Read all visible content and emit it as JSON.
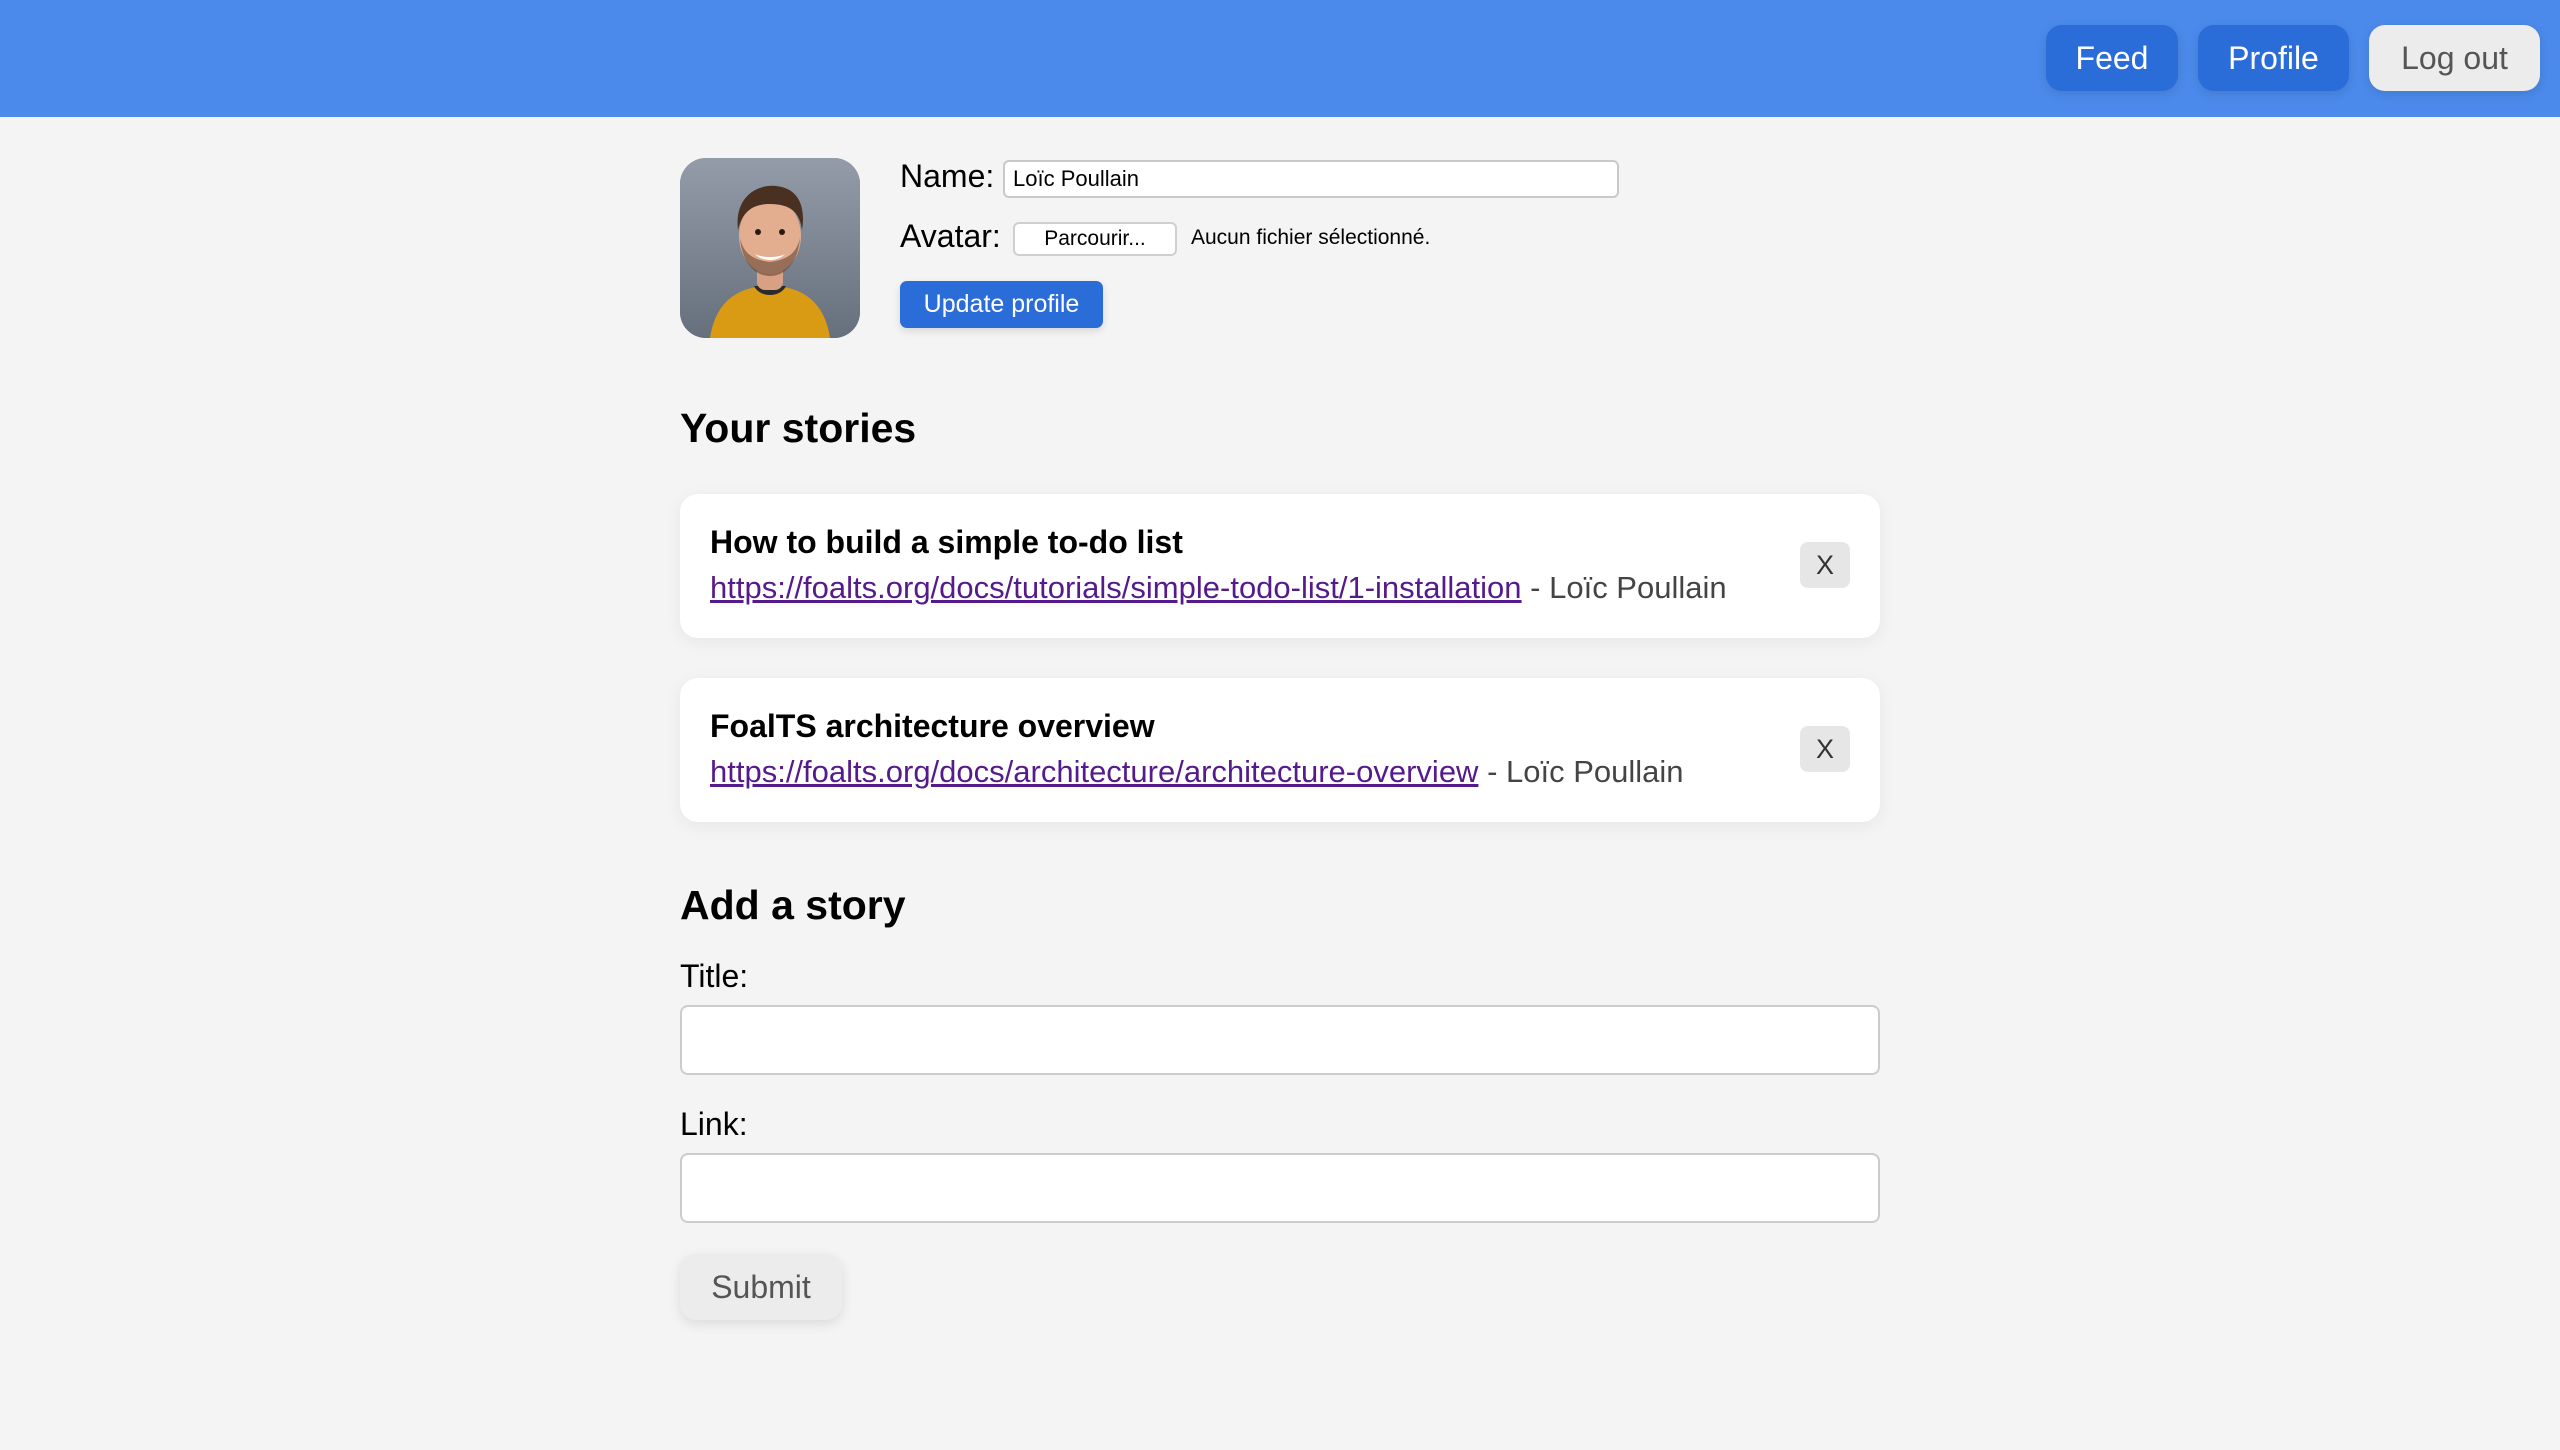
{
  "nav": {
    "feed_label": "Feed",
    "profile_label": "Profile",
    "logout_label": "Log out"
  },
  "profile": {
    "name_label": "Name:",
    "name_value": "Loïc Poullain",
    "avatar_label": "Avatar:",
    "file_button_label": "Parcourir...",
    "file_status": "Aucun fichier sélectionné.",
    "update_label": "Update profile"
  },
  "stories": {
    "heading": "Your stories",
    "items": [
      {
        "title": "How to build a simple to-do list",
        "link": "https://foalts.org/docs/tutorials/simple-todo-list/1-installation",
        "author": "Loïc Poullain",
        "separator": " - ",
        "delete_label": "X"
      },
      {
        "title": "FoalTS architecture overview",
        "link": "https://foalts.org/docs/architecture/architecture-overview",
        "author": "Loïc Poullain",
        "separator": " - ",
        "delete_label": "X"
      }
    ]
  },
  "add_story": {
    "heading": "Add a story",
    "title_label": "Title:",
    "title_value": "",
    "link_label": "Link:",
    "link_value": "",
    "submit_label": "Submit"
  },
  "colors": {
    "header": "#4b8aeb",
    "primary_button": "#2a6cd8",
    "secondary_button": "#ececec",
    "background": "#f4f4f4",
    "visited_link": "#551a8b"
  }
}
